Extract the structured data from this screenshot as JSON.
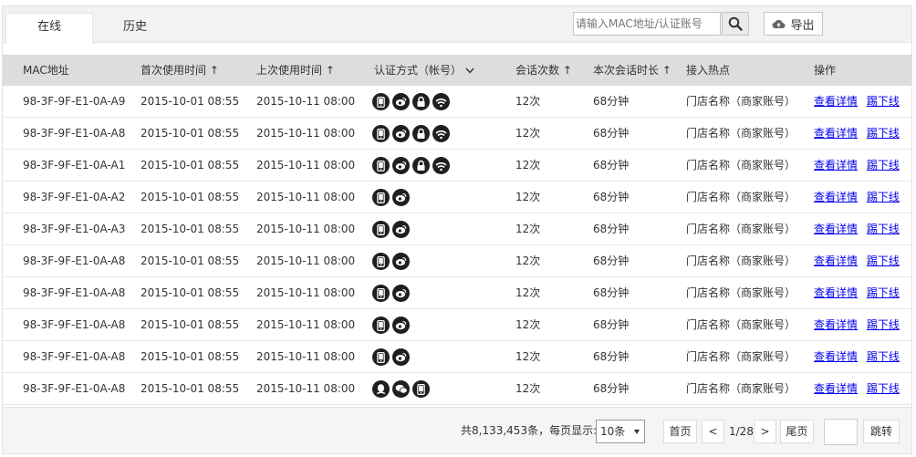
{
  "tabs": [
    {
      "label": "在线",
      "active": true
    },
    {
      "label": "历史",
      "active": false
    }
  ],
  "search": {
    "placeholder": "请输入MAC地址/认证账号",
    "value": ""
  },
  "export_label": "导出",
  "columns": [
    "MAC地址",
    "首次使用时间 ↑",
    "上次使用时间 ↑",
    "认证方式（帐号）",
    "会话次数 ↑",
    "本次会话时长 ↑",
    "接入热点",
    "操作"
  ],
  "actions": {
    "detail": "查看详情",
    "kick": "踢下线"
  },
  "auth_icon_names": {
    "phone": "phone-icon",
    "weibo": "weibo-icon",
    "lock": "lock-icon",
    "wifi": "wifi-icon",
    "qq": "qq-icon",
    "wechat": "wechat-icon"
  },
  "rows": [
    {
      "mac": "98-3F-9F-E1-0A-A9",
      "first": "2015-10-01 08:55",
      "last": "2015-10-11 08:00",
      "auth": [
        "phone",
        "weibo",
        "lock",
        "wifi"
      ],
      "sessions": "12次",
      "duration": "68分钟",
      "hotspot": "门店名称（商家账号）"
    },
    {
      "mac": "98-3F-9F-E1-0A-A8",
      "first": "2015-10-01 08:55",
      "last": "2015-10-11 08:00",
      "auth": [
        "phone",
        "weibo",
        "lock",
        "wifi"
      ],
      "sessions": "12次",
      "duration": "68分钟",
      "hotspot": "门店名称（商家账号）"
    },
    {
      "mac": "98-3F-9F-E1-0A-A1",
      "first": "2015-10-01 08:55",
      "last": "2015-10-11 08:00",
      "auth": [
        "phone",
        "weibo",
        "lock",
        "wifi"
      ],
      "sessions": "12次",
      "duration": "68分钟",
      "hotspot": "门店名称（商家账号）"
    },
    {
      "mac": "98-3F-9F-E1-0A-A2",
      "first": "2015-10-01 08:55",
      "last": "2015-10-11 08:00",
      "auth": [
        "phone",
        "weibo"
      ],
      "sessions": "12次",
      "duration": "68分钟",
      "hotspot": "门店名称（商家账号）"
    },
    {
      "mac": "98-3F-9F-E1-0A-A3",
      "first": "2015-10-01 08:55",
      "last": "2015-10-11 08:00",
      "auth": [
        "phone",
        "weibo"
      ],
      "sessions": "12次",
      "duration": "68分钟",
      "hotspot": "门店名称（商家账号）"
    },
    {
      "mac": "98-3F-9F-E1-0A-A8",
      "first": "2015-10-01 08:55",
      "last": "2015-10-11 08:00",
      "auth": [
        "phone",
        "weibo"
      ],
      "sessions": "12次",
      "duration": "68分钟",
      "hotspot": "门店名称（商家账号）"
    },
    {
      "mac": "98-3F-9F-E1-0A-A8",
      "first": "2015-10-01 08:55",
      "last": "2015-10-11 08:00",
      "auth": [
        "phone",
        "weibo"
      ],
      "sessions": "12次",
      "duration": "68分钟",
      "hotspot": "门店名称（商家账号）"
    },
    {
      "mac": "98-3F-9F-E1-0A-A8",
      "first": "2015-10-01 08:55",
      "last": "2015-10-11 08:00",
      "auth": [
        "phone",
        "weibo"
      ],
      "sessions": "12次",
      "duration": "68分钟",
      "hotspot": "门店名称（商家账号）"
    },
    {
      "mac": "98-3F-9F-E1-0A-A8",
      "first": "2015-10-01 08:55",
      "last": "2015-10-11 08:00",
      "auth": [
        "phone",
        "weibo"
      ],
      "sessions": "12次",
      "duration": "68分钟",
      "hotspot": "门店名称（商家账号）"
    },
    {
      "mac": "98-3F-9F-E1-0A-A8",
      "first": "2015-10-01 08:55",
      "last": "2015-10-11 08:00",
      "auth": [
        "qq",
        "wechat",
        "phone"
      ],
      "sessions": "12次",
      "duration": "68分钟",
      "hotspot": "门店名称（商家账号）"
    }
  ],
  "pagination": {
    "total_text": "共8,133,453条，每页显示:",
    "page_size": "10条",
    "first": "首页",
    "prev": "<",
    "info": "1/28",
    "next": ">",
    "last": "尾页",
    "jump": "跳转"
  }
}
